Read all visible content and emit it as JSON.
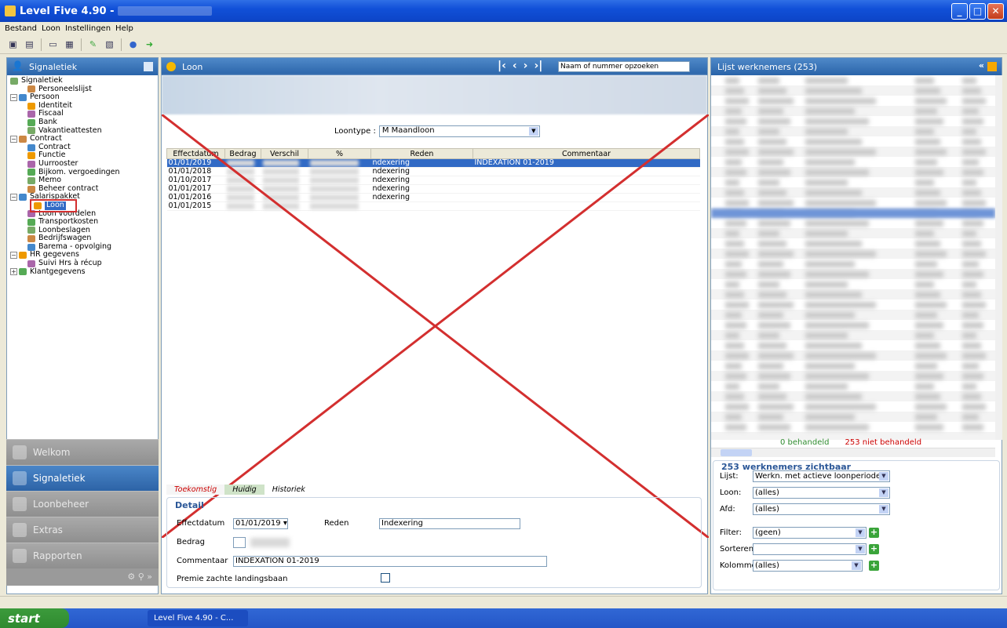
{
  "window": {
    "title": "Level Five 4.90  -"
  },
  "menu": [
    "Bestand",
    "Loon",
    "Instellingen",
    "Help"
  ],
  "left": {
    "header": "Signaletiek",
    "tree": [
      {
        "label": "Signaletiek",
        "level": 0
      },
      {
        "label": "Personeelslijst",
        "level": 1
      },
      {
        "label": "Persoon",
        "level": 0,
        "expander": "−"
      },
      {
        "label": "Identiteit",
        "level": 1
      },
      {
        "label": "Fiscaal",
        "level": 1
      },
      {
        "label": "Bank",
        "level": 1
      },
      {
        "label": "Vakantieattesten",
        "level": 1
      },
      {
        "label": "Contract",
        "level": 0,
        "expander": "−"
      },
      {
        "label": "Contract",
        "level": 1
      },
      {
        "label": "Functie",
        "level": 1
      },
      {
        "label": "Uurrooster",
        "level": 1
      },
      {
        "label": "Bijkom. vergoedingen",
        "level": 1
      },
      {
        "label": "Memo",
        "level": 1
      },
      {
        "label": "Beheer contract",
        "level": 1
      },
      {
        "label": "Salarispakket",
        "level": 0,
        "expander": "−"
      },
      {
        "label": "Loon",
        "level": 1,
        "selected": true
      },
      {
        "label": "Loon voordelen",
        "level": 1
      },
      {
        "label": "Transportkosten",
        "level": 1
      },
      {
        "label": "Loonbeslagen",
        "level": 1
      },
      {
        "label": "Bedrijfswagen",
        "level": 1
      },
      {
        "label": "Barema - opvolging",
        "level": 1
      },
      {
        "label": "HR gegevens",
        "level": 0,
        "expander": "−"
      },
      {
        "label": "Suivi Hrs à récup",
        "level": 1
      },
      {
        "label": "Klantgegevens",
        "level": 0,
        "expander": "+"
      }
    ],
    "nav": [
      {
        "label": "Welkom",
        "active": false
      },
      {
        "label": "Signaletiek",
        "active": true
      },
      {
        "label": "Loonbeheer",
        "active": false
      },
      {
        "label": "Extras",
        "active": false
      },
      {
        "label": "Rapporten",
        "active": false
      }
    ]
  },
  "center": {
    "header": "Loon",
    "search_placeholder": "Naam of nummer opzoeken",
    "loontype_label": "Loontype :",
    "loontype_value": "M  Maandloon",
    "columns": [
      "Effectdatum",
      "Bedrag",
      "Verschil",
      "%",
      "Reden",
      "Commentaar"
    ],
    "rows": [
      {
        "date": "01/01/2019",
        "reden": "ndexering",
        "comment": "INDEXATION 01-2019",
        "selected": true
      },
      {
        "date": "01/01/2018",
        "reden": "ndexering",
        "comment": ""
      },
      {
        "date": "01/10/2017",
        "reden": "ndexering",
        "comment": ""
      },
      {
        "date": "01/01/2017",
        "reden": "ndexering",
        "comment": ""
      },
      {
        "date": "01/01/2016",
        "reden": "ndexering",
        "comment": ""
      },
      {
        "date": "01/01/2015",
        "reden": "",
        "comment": ""
      }
    ],
    "tabs": [
      "Toekomstig",
      "Huidig",
      "Historiek"
    ],
    "detail": {
      "legend": "Detail",
      "effectdatum_label": "Effectdatum",
      "effectdatum_value": "01/01/2019",
      "reden_label": "Reden",
      "reden_value": "Indexering",
      "bedrag_label": "Bedrag",
      "commentaar_label": "Commentaar",
      "commentaar_value": "INDEXATION 01-2019",
      "premie_label": "Premie zachte landingsbaan"
    }
  },
  "right": {
    "header": "Lijst werknemers (253)",
    "behandeld": "0 behandeld",
    "niet_behandeld": "253 niet behandeld",
    "visible_legend": "253 werknemers zichtbaar",
    "filters": [
      {
        "label": "Lijst:",
        "value": "Werkn. met actieve loonperiode",
        "plus": false
      },
      {
        "label": "Loon:",
        "value": "(alles)",
        "plus": false
      },
      {
        "label": "Afd:",
        "value": "(alles)",
        "plus": false
      },
      {
        "label": "Filter:",
        "value": "(geen)",
        "plus": true
      },
      {
        "label": "Sorteren:",
        "value": "",
        "plus": true
      },
      {
        "label": "Kolommen:",
        "value": "(alles)",
        "plus": true
      }
    ]
  },
  "taskbar": {
    "start": "start",
    "item": "Level Five 4.90  -  C..."
  },
  "colors": {
    "accent": "#2a64a9",
    "selection": "#316ac5",
    "annotation": "#d32f2f"
  }
}
